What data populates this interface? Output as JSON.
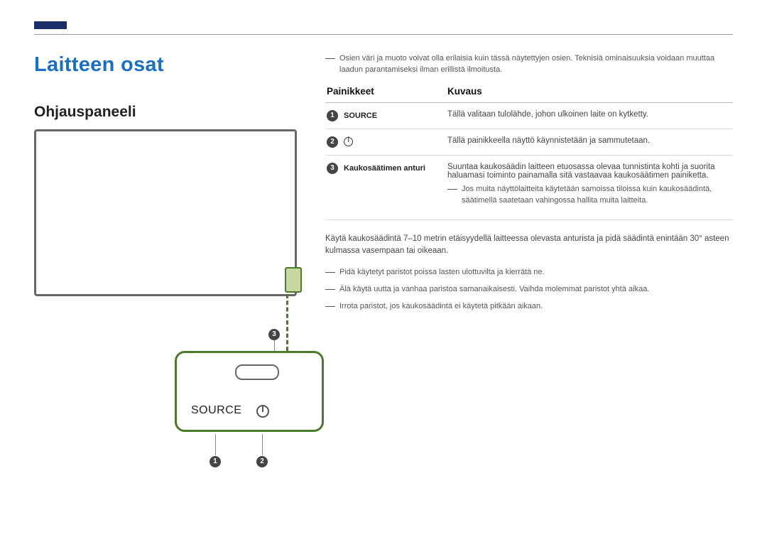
{
  "heading": "Laitteen osat",
  "subheading": "Ohjauspaneeli",
  "top_note": "Osien väri ja muoto voivat olla erilaisia kuin tässä näytettyjen osien. Teknisiä ominaisuuksia voidaan muuttaa laadun parantamiseksi ilman erillistä ilmoitusta.",
  "table": {
    "col1": "Painikkeet",
    "col2": "Kuvaus",
    "rows": [
      {
        "num": "1",
        "label": "SOURCE",
        "desc": "Tällä valitaan tulolähde, johon ulkoinen laite on kytketty."
      },
      {
        "num": "2",
        "label": "",
        "icon": "power",
        "desc": "Tällä painikkeella näyttö käynnistetään ja sammutetaan."
      },
      {
        "num": "3",
        "label": "Kaukosäätimen anturi",
        "desc": "Suuntaa kaukosäädin laitteen etuosassa olevaa tunnistinta kohti ja suorita haluamasi toiminto painamalla sitä vastaavaa kaukosäätimen painiketta.",
        "note": "Jos muita näyttölaitteita käytetään samoissa tiloissa kuin kaukosäädintä, säätimellä saatetaan vahingossa hallita muita laitteita."
      }
    ]
  },
  "usage_text": "Käytä kaukosäädintä 7–10 metrin etäisyydellä laitteessa olevasta anturista ja pidä säädintä enintään 30° asteen kulmassa vasempaan tai oikeaan.",
  "bullets": [
    "Pidä käytetyt paristot poissa lasten ulottuvilta ja kierrätä ne.",
    "Älä käytä uutta ja vanhaa paristoa samanaikaisesti. Vaihda molemmat paristot yhtä aikaa.",
    "Irrota paristot, jos kaukosäädintä ei käytetä pitkään aikaan."
  ],
  "panel_label": "SOURCE",
  "callouts": {
    "c1": "1",
    "c2": "2",
    "c3": "3"
  }
}
